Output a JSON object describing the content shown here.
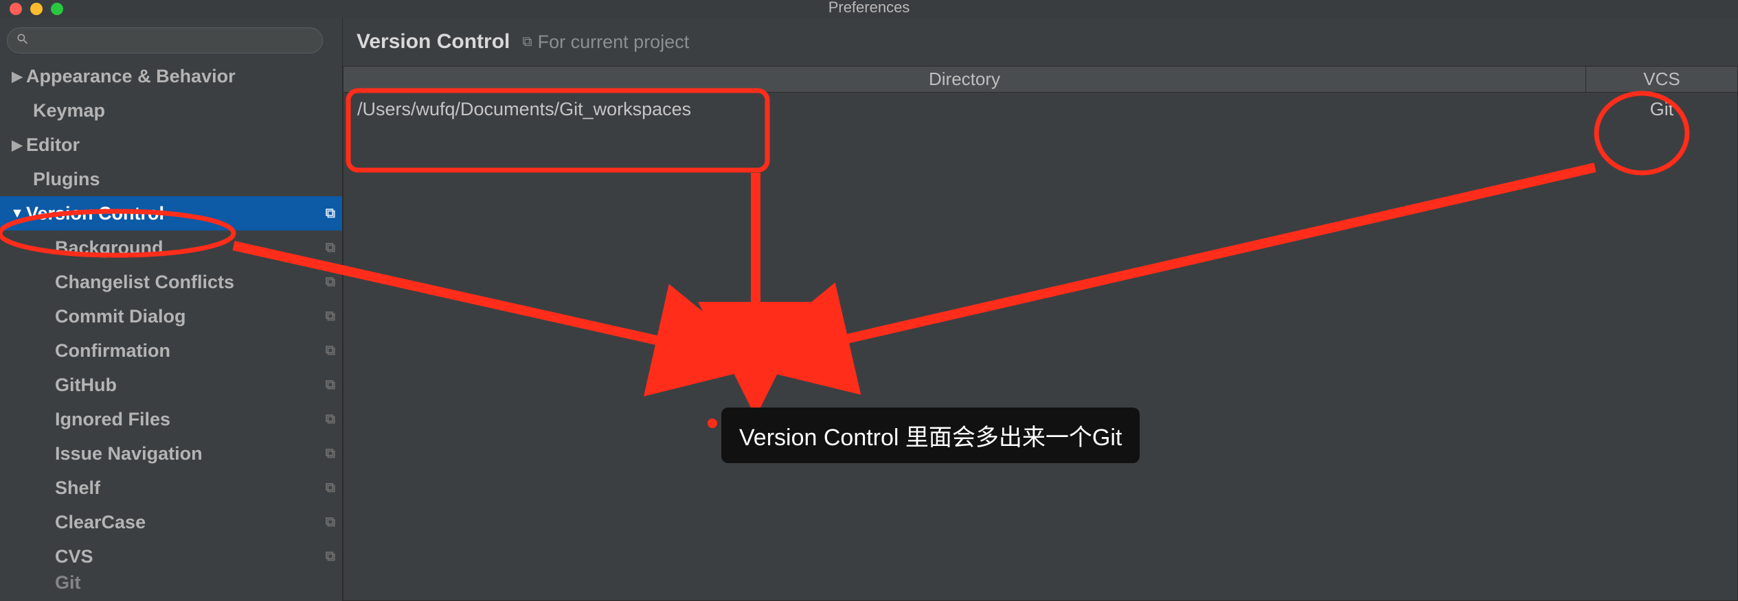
{
  "window": {
    "title": "Preferences"
  },
  "search": {
    "placeholder": ""
  },
  "sidebar": {
    "items": [
      {
        "label": "Appearance & Behavior",
        "expandable": true
      },
      {
        "label": "Keymap"
      },
      {
        "label": "Editor",
        "expandable": true
      },
      {
        "label": "Plugins"
      },
      {
        "label": "Version Control",
        "expandable": true,
        "selected": true,
        "children": [
          {
            "label": "Background"
          },
          {
            "label": "Changelist Conflicts"
          },
          {
            "label": "Commit Dialog"
          },
          {
            "label": "Confirmation"
          },
          {
            "label": "GitHub"
          },
          {
            "label": "Ignored Files"
          },
          {
            "label": "Issue Navigation"
          },
          {
            "label": "Shelf"
          },
          {
            "label": "ClearCase"
          },
          {
            "label": "CVS"
          },
          {
            "label": "Git"
          }
        ]
      }
    ]
  },
  "main": {
    "title": "Version Control",
    "scope_label": "For current project",
    "table": {
      "columns": {
        "directory": "Directory",
        "vcs": "VCS"
      },
      "rows": [
        {
          "directory": "/Users/wufq/Documents/Git_workspaces",
          "vcs": "Git"
        }
      ]
    }
  },
  "annotation": {
    "tooltip": "Version Control 里面会多出来一个Git"
  }
}
